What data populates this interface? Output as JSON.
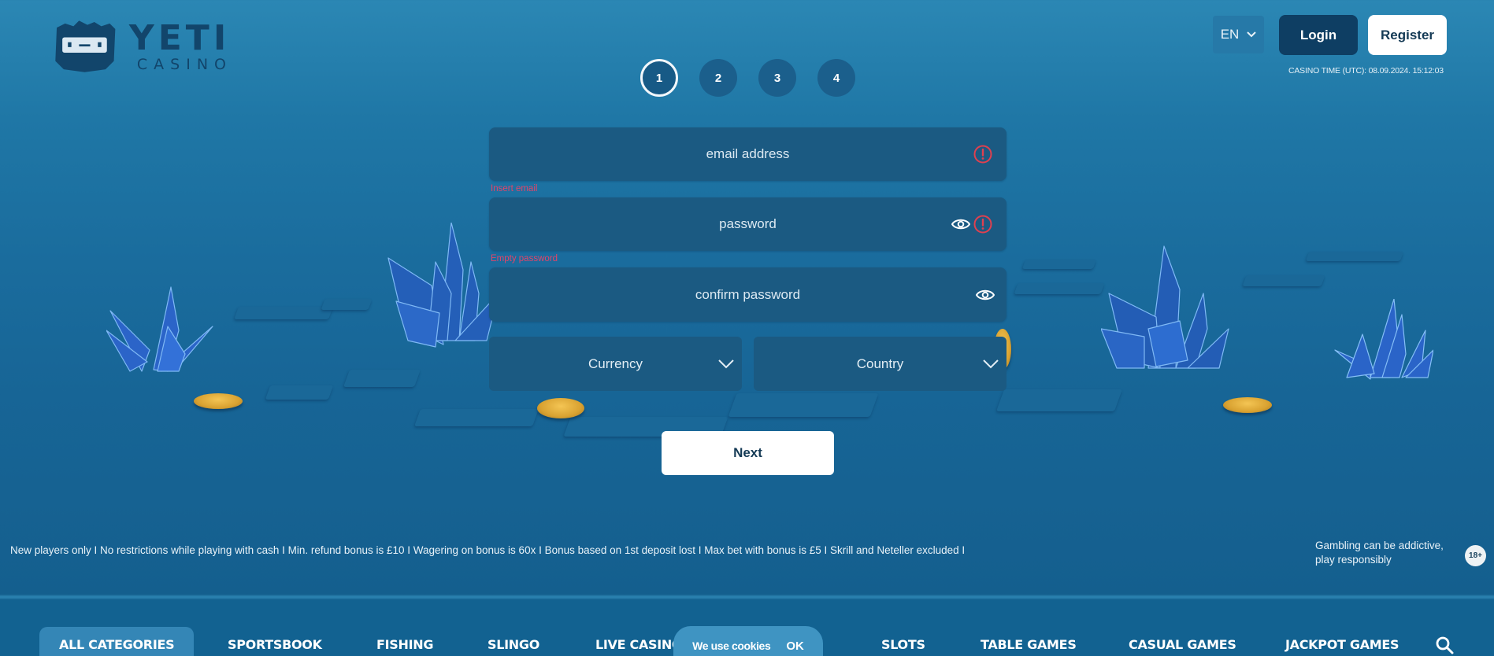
{
  "brand": {
    "name": "YETI",
    "subtitle": "CASINO",
    "logo_icon": "yeti-face-icon"
  },
  "header": {
    "language": "EN",
    "login_label": "Login",
    "register_label": "Register",
    "casino_time": "CASINO TIME (UTC): 08.09.2024. 15:12:03"
  },
  "steps": {
    "current": 1,
    "items": [
      "1",
      "2",
      "3",
      "4"
    ]
  },
  "form": {
    "email": {
      "placeholder": "email address",
      "value": "",
      "error": "Insert email",
      "error_icon": "alert-circle-icon"
    },
    "password": {
      "placeholder": "password",
      "value": "",
      "error": "Empty password",
      "toggle_icon": "eye-icon",
      "error_icon": "alert-circle-icon"
    },
    "confirm_password": {
      "placeholder": "confirm password",
      "value": "",
      "toggle_icon": "eye-icon"
    },
    "currency": {
      "label": "Currency"
    },
    "country": {
      "label": "Country"
    },
    "next_label": "Next"
  },
  "footer": {
    "disclaimer": "New players only I No restrictions while playing with cash I Min. refund bonus is £10 I Wagering on bonus is 60x I Bonus based on 1st deposit lost I Max bet with bonus is £5 I Skrill and Neteller excluded I",
    "gambling_line1": "Gambling can be addictive,",
    "gambling_line2": "play responsibly",
    "age_badge": "18+"
  },
  "nav": {
    "items": [
      {
        "label": "ALL CATEGORIES",
        "active": true
      },
      {
        "label": "SPORTSBOOK"
      },
      {
        "label": "FISHING"
      },
      {
        "label": "SLINGO"
      },
      {
        "label": "LIVE CASINO"
      },
      {
        "label": "SLOTS"
      },
      {
        "label": "TABLE GAMES"
      },
      {
        "label": "CASUAL GAMES"
      },
      {
        "label": "JACKPOT GAMES"
      }
    ],
    "search_icon": "search-icon"
  },
  "cookie_banner": {
    "text": "We use cookies",
    "ok_label": "OK"
  },
  "colors": {
    "background": "#1f77a6",
    "field": "#1b5a82",
    "login_button": "#0e3e63",
    "error": "#e0456a",
    "nav_active": "#3486b6",
    "cookie_banner": "#3f94c2"
  }
}
